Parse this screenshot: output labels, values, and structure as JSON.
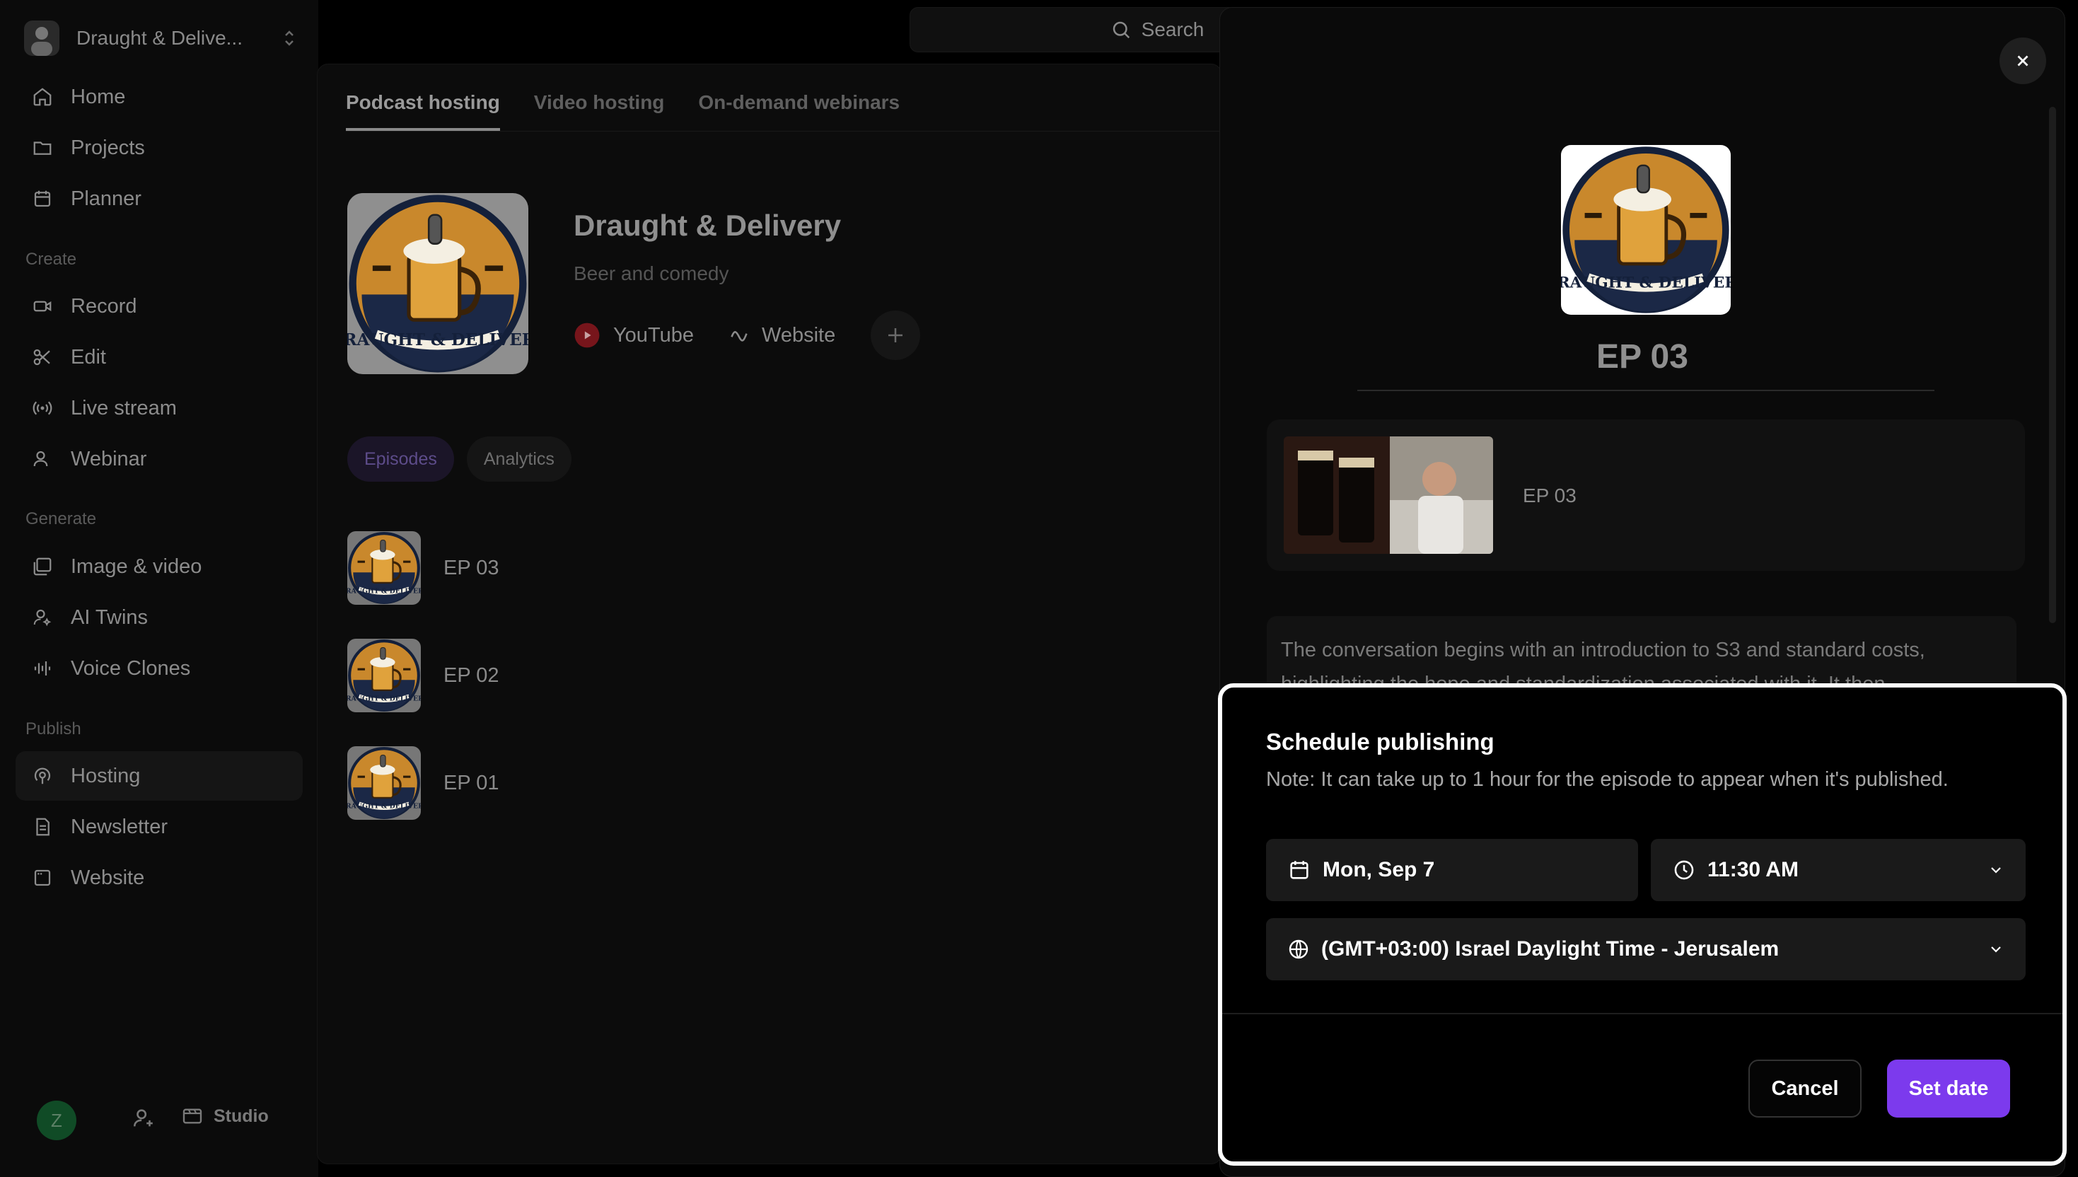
{
  "workspace": {
    "name": "Draught & Delive..."
  },
  "sidebar": {
    "items": [
      {
        "label": "Home",
        "icon": "home-icon"
      },
      {
        "label": "Projects",
        "icon": "folder-icon"
      },
      {
        "label": "Planner",
        "icon": "calendar-icon"
      }
    ],
    "create": {
      "title": "Create",
      "items": [
        {
          "label": "Record",
          "icon": "video-camera-icon"
        },
        {
          "label": "Edit",
          "icon": "scissors-icon"
        },
        {
          "label": "Live stream",
          "icon": "broadcast-icon"
        },
        {
          "label": "Webinar",
          "icon": "people-icon"
        }
      ]
    },
    "generate": {
      "title": "Generate",
      "items": [
        {
          "label": "Image & video",
          "icon": "image-icon"
        },
        {
          "label": "AI Twins",
          "icon": "ai-twin-icon"
        },
        {
          "label": "Voice Clones",
          "icon": "waveform-icon"
        }
      ]
    },
    "publish": {
      "title": "Publish",
      "items": [
        {
          "label": "Hosting",
          "icon": "podcast-icon",
          "active": true
        },
        {
          "label": "Newsletter",
          "icon": "document-icon"
        },
        {
          "label": "Website",
          "icon": "browser-icon"
        }
      ]
    },
    "footer": {
      "user_initial": "Z",
      "studio_label": "Studio"
    }
  },
  "search": {
    "label": "Search"
  },
  "main": {
    "tabs": [
      {
        "label": "Podcast hosting",
        "active": true
      },
      {
        "label": "Video hosting"
      },
      {
        "label": "On-demand webinars"
      }
    ],
    "show": {
      "title": "Draught & Delivery",
      "subtitle": "Beer and comedy",
      "links": [
        {
          "label": "YouTube",
          "icon": "youtube-icon"
        },
        {
          "label": "Website",
          "icon": "website-wave-icon"
        }
      ]
    },
    "pills": [
      {
        "label": "Episodes",
        "active": true
      },
      {
        "label": "Analytics"
      }
    ],
    "episodes": [
      {
        "title": "EP 03"
      },
      {
        "title": "EP 02"
      },
      {
        "title": "EP 01"
      }
    ]
  },
  "panel": {
    "episode_title": "EP 03",
    "media_title": "EP 03",
    "description": "The conversation begins with an introduction to S3 and standard costs, highlighting the hope and standardization associated with it. It then"
  },
  "dialog": {
    "title": "Schedule publishing",
    "note": "Note: It can take up to 1 hour for the episode to appear when it's published.",
    "date": "Mon, Sep 7",
    "time": "11:30 AM",
    "timezone": "(GMT+03:00) Israel Daylight Time - Jerusalem",
    "cancel_label": "Cancel",
    "confirm_label": "Set date"
  },
  "colors": {
    "accent": "#7c3aed",
    "background": "#000000",
    "youtube": "#e11d2a",
    "user_avatar": "#15803d"
  }
}
